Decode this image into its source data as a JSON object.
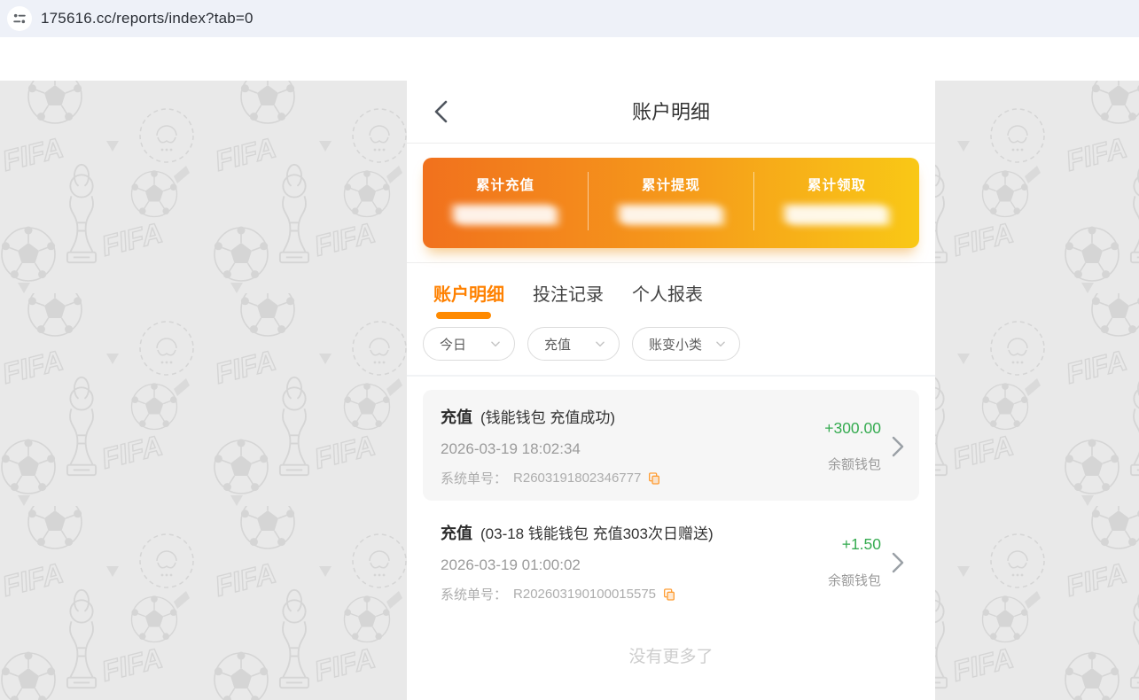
{
  "browser": {
    "url": "175616.cc/reports/index?tab=0"
  },
  "header": {
    "title": "账户明细"
  },
  "stats_card": {
    "gradient_start": "#f1711d",
    "gradient_end": "#f9c816",
    "items": [
      {
        "label": "累计充值",
        "value_masked": true
      },
      {
        "label": "累计提现",
        "value_masked": true
      },
      {
        "label": "累计领取",
        "value_masked": true
      }
    ]
  },
  "tabs": [
    {
      "label": "账户明细",
      "active": true
    },
    {
      "label": "投注记录",
      "active": false
    },
    {
      "label": "个人报表",
      "active": false
    }
  ],
  "filters": [
    {
      "value": "今日"
    },
    {
      "value": "充值"
    },
    {
      "value": "账变小类"
    }
  ],
  "transactions": [
    {
      "type": "充值",
      "desc": "(钱能钱包 充值成功)",
      "datetime": "2026-03-19 18:02:34",
      "order_label": "系统单号：",
      "order_no": "R2603191802346777",
      "amount": "+300.00",
      "wallet": "余额钱包"
    },
    {
      "type": "充值",
      "desc": "(03-18 钱能钱包 充值303次日赠送)",
      "datetime": "2026-03-19 01:00:02",
      "order_label": "系统单号：",
      "order_no": "R202603190100015575",
      "amount": "+1.50",
      "wallet": "余额钱包"
    }
  ],
  "footer": {
    "no_more_text": "没有更多了"
  },
  "colors": {
    "accent_orange": "#ff8100",
    "amount_green": "#35ab50",
    "copy_icon_orange": "#ff9d33",
    "pattern_bg": "#e9e9e9",
    "pattern_line": "#d5d5d5"
  },
  "icons": {
    "browser_badge": "site-settings-icon",
    "header_back": "chevron-left-icon",
    "filter_dropdown": "chevron-down-icon",
    "order_copy": "copy-icon",
    "row_arrow": "chevron-right-icon",
    "background": "fifa-club-world-cup-watermark"
  }
}
